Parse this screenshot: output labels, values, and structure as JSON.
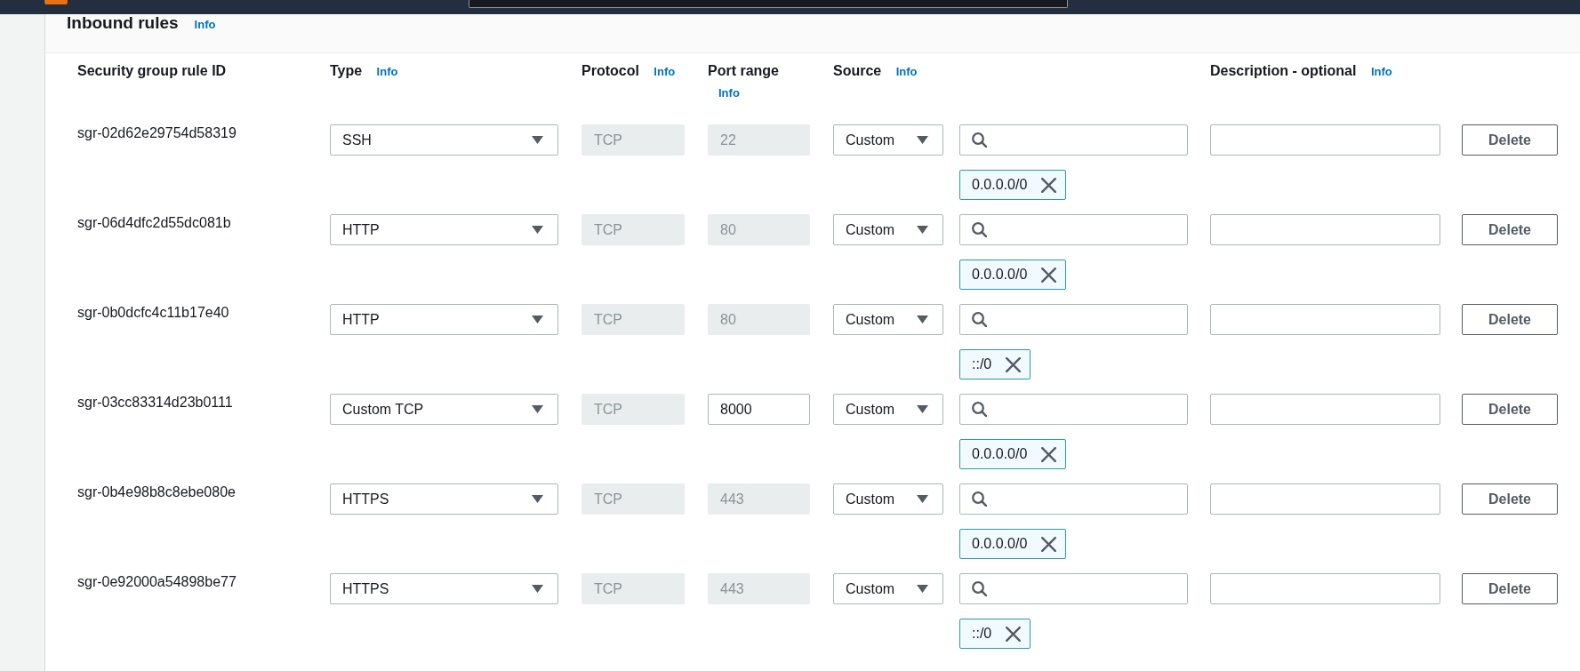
{
  "section": {
    "title": "Inbound rules",
    "info": "Info"
  },
  "columns": [
    {
      "label": "Security group rule ID"
    },
    {
      "label": "Type",
      "info": "Info"
    },
    {
      "label": "Protocol",
      "info": "Info"
    },
    {
      "label": "Port range",
      "info": "Info"
    },
    {
      "label": "Source",
      "info": "Info"
    },
    {
      "label": "Description - optional",
      "info": "Info"
    }
  ],
  "rules": [
    {
      "id": "sgr-02d62e29754d58319",
      "type": "SSH",
      "protocol": {
        "value": "TCP",
        "disabled": true
      },
      "port_range": {
        "value": "22",
        "disabled": true
      },
      "source": "Custom",
      "cidrs": [
        "0.0.0.0/0"
      ],
      "action": "Delete"
    },
    {
      "id": "sgr-06d4dfc2d55dc081b",
      "type": "HTTP",
      "protocol": {
        "value": "TCP",
        "disabled": true
      },
      "port_range": {
        "value": "80",
        "disabled": true
      },
      "source": "Custom",
      "cidrs": [
        "0.0.0.0/0"
      ],
      "action": "Delete"
    },
    {
      "id": "sgr-0b0dcfc4c11b17e40",
      "type": "HTTP",
      "protocol": {
        "value": "TCP",
        "disabled": true
      },
      "port_range": {
        "value": "80",
        "disabled": true
      },
      "source": "Custom",
      "cidrs": [
        "::/0"
      ],
      "action": "Delete"
    },
    {
      "id": "sgr-03cc83314d23b0111",
      "type": "Custom TCP",
      "protocol": {
        "value": "TCP",
        "disabled": true
      },
      "port_range": {
        "value": "8000",
        "disabled": false
      },
      "source": "Custom",
      "cidrs": [
        "0.0.0.0/0"
      ],
      "action": "Delete"
    },
    {
      "id": "sgr-0b4e98b8c8ebe080e",
      "type": "HTTPS",
      "protocol": {
        "value": "TCP",
        "disabled": true
      },
      "port_range": {
        "value": "443",
        "disabled": true
      },
      "source": "Custom",
      "cidrs": [
        "0.0.0.0/0"
      ],
      "action": "Delete"
    },
    {
      "id": "sgr-0e92000a54898be77",
      "type": "HTTPS",
      "protocol": {
        "value": "TCP",
        "disabled": true
      },
      "port_range": {
        "value": "443",
        "disabled": true
      },
      "source": "Custom",
      "cidrs": [
        "::/0"
      ],
      "action": "Delete"
    }
  ]
}
